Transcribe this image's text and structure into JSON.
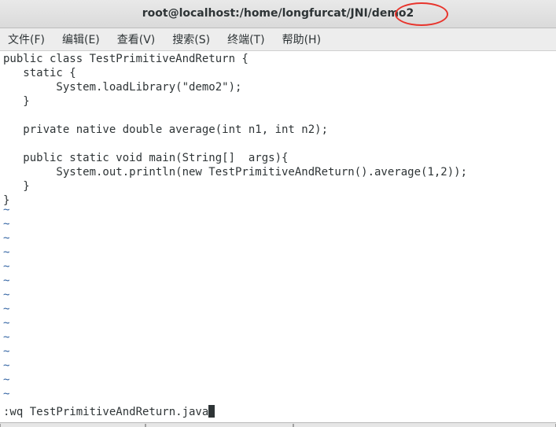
{
  "window": {
    "title": "root@localhost:/home/longfurcat/JNI/demo2",
    "highlight_color": "#e8342c"
  },
  "menubar": {
    "items": [
      {
        "label": "文件(F)"
      },
      {
        "label": "编辑(E)"
      },
      {
        "label": "查看(V)"
      },
      {
        "label": "搜索(S)"
      },
      {
        "label": "终端(T)"
      },
      {
        "label": "帮助(H)"
      }
    ]
  },
  "editor": {
    "lines": [
      "public class TestPrimitiveAndReturn {",
      "   static {",
      "        System.loadLibrary(\"demo2\");",
      "   }",
      "",
      "   private native double average(int n1, int n2);",
      "",
      "   public static void main(String[]  args){",
      "        System.out.println(new TestPrimitiveAndReturn().average(1,2));",
      "   }",
      "}"
    ],
    "tilde_char": "~",
    "tilde_color": "#3465a4",
    "command_line": ":wq TestPrimitiveAndReturn.java"
  }
}
